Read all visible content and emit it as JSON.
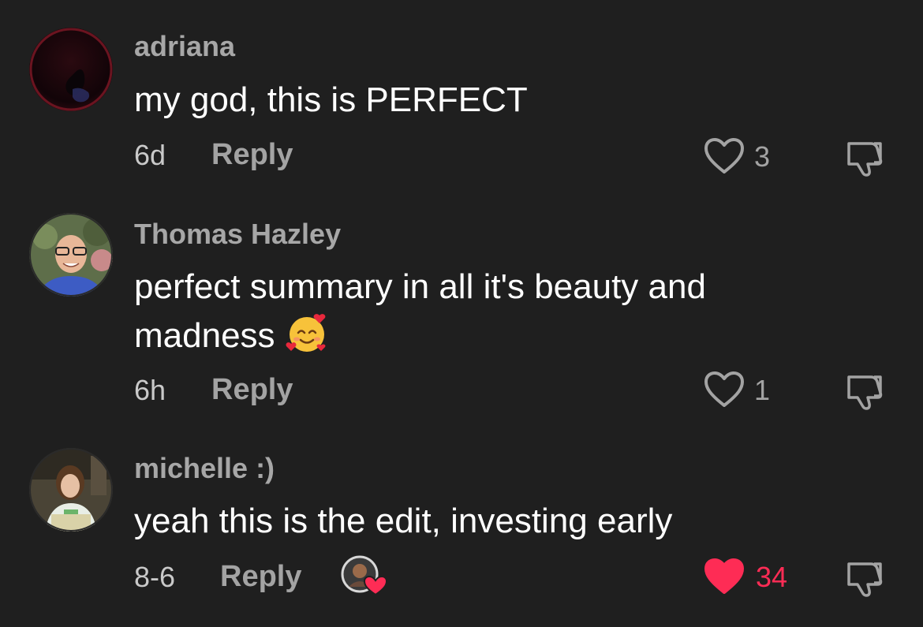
{
  "colors": {
    "background": "#1f1f1f",
    "username": "#a7a7a7",
    "secondary": "#a3a3a3",
    "like_active": "#fe2c55"
  },
  "comments": [
    {
      "username": "adriana",
      "text": "my god, this is PERFECT",
      "time": "6d",
      "reply_label": "Reply",
      "likes": "3",
      "liked": false,
      "avatar_icon": "avatar-dark-photo"
    },
    {
      "username": "Thomas Hazley",
      "text_line1": "perfect summary in all it's beauty and",
      "text_line2": "madness",
      "emoji": "smiling-face-with-hearts",
      "time": "6h",
      "reply_label": "Reply",
      "likes": "1",
      "liked": false,
      "avatar_icon": "avatar-man-glasses"
    },
    {
      "username": "michelle :)",
      "text": "yeah this is the edit, investing early",
      "time": "8-6",
      "reply_label": "Reply",
      "likes": "34",
      "liked": true,
      "creator_liked_icon": "creator-liked-avatar",
      "avatar_icon": "avatar-woman-photo"
    }
  ]
}
